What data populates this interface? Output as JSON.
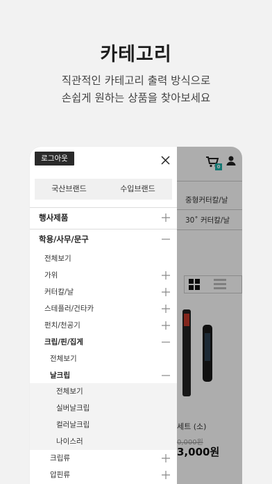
{
  "hero": {
    "title": "카테고리",
    "subtitle_line1": "직관적인 카테고리 출력 방식으로",
    "subtitle_line2": "손쉽게 원하는 상품을 찾아보세요"
  },
  "drawer": {
    "logout_label": "로그아웃",
    "brand_domestic": "국산브랜드",
    "brand_import": "수입브랜드",
    "event_label": "행사제품",
    "main_category": "학용/사무/문구",
    "items": {
      "all": "전체보기",
      "scissors": "가위",
      "cutter": "커터칼/날",
      "stapler": "스테플러/건타카",
      "punch": "펀치/천공기",
      "clip": "크립/핀/집게"
    },
    "clip_sub": {
      "all": "전체보기",
      "single_clip": "날크립"
    },
    "single_clip_sub": {
      "all": "전체보기",
      "silver": "실버날크립",
      "color": "컬러날크립",
      "nicer": "나이스러"
    },
    "clip_type": "크립류",
    "push_pin": "압핀류"
  },
  "background": {
    "cart_badge": "0",
    "cat_row1": "중형커터칼/날",
    "cat_row2": "30˚ 커터칼/날",
    "product_name": "세트 (소)",
    "product_old_price": "0,000원",
    "product_price": "3,000원"
  },
  "colors": {
    "accent": "#1db0a8",
    "logout_bg": "#2a2a2a",
    "shade_row": "#f3f3f3"
  }
}
